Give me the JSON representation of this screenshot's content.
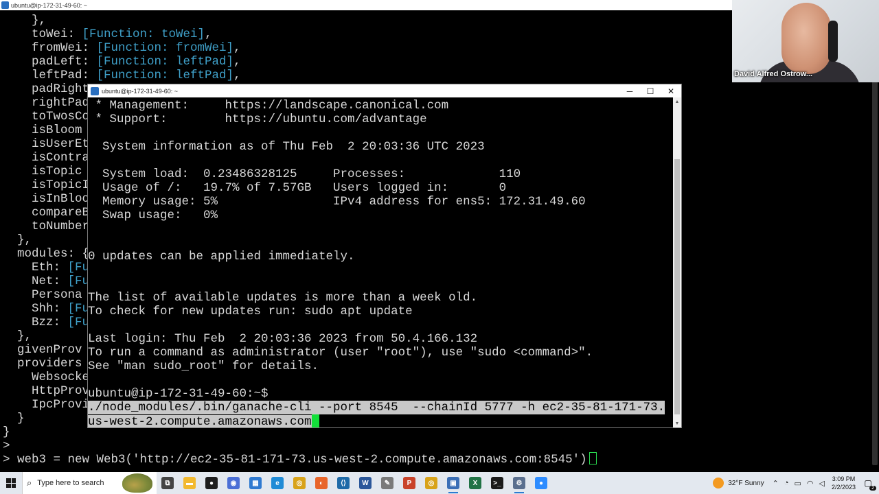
{
  "background_window": {
    "title": "ubuntu@ip-172-31-49-60: ~",
    "lines": [
      {
        "pre": "    },",
        "fn": "",
        "post": ""
      },
      {
        "pre": "    toWei: ",
        "fn": "[Function: toWei]",
        "post": ","
      },
      {
        "pre": "    fromWei: ",
        "fn": "[Function: fromWei]",
        "post": ","
      },
      {
        "pre": "    padLeft: ",
        "fn": "[Function: leftPad]",
        "post": ","
      },
      {
        "pre": "    leftPad: ",
        "fn": "[Function: leftPad]",
        "post": ","
      },
      {
        "pre": "    padRight",
        "fn": "",
        "post": ""
      },
      {
        "pre": "    rightPad",
        "fn": "",
        "post": ""
      },
      {
        "pre": "    toTwosCo",
        "fn": "",
        "post": ""
      },
      {
        "pre": "    isBloom",
        "fn": "",
        "post": ""
      },
      {
        "pre": "    isUserEt",
        "fn": "",
        "post": ""
      },
      {
        "pre": "    isContra",
        "fn": "",
        "post": ""
      },
      {
        "pre": "    isTopic",
        "fn": "",
        "post": ""
      },
      {
        "pre": "    isTopicI",
        "fn": "",
        "post": ""
      },
      {
        "pre": "    isInBloo",
        "fn": "",
        "post": ""
      },
      {
        "pre": "    compareB",
        "fn": "",
        "post": ""
      },
      {
        "pre": "    toNumber",
        "fn": "",
        "post": ""
      },
      {
        "pre": "  },",
        "fn": "",
        "post": ""
      },
      {
        "pre": "  modules: {",
        "fn": "",
        "post": ""
      },
      {
        "pre": "    Eth: ",
        "fn": "[Fu",
        "post": ""
      },
      {
        "pre": "    Net: ",
        "fn": "[Fu",
        "post": ""
      },
      {
        "pre": "    Persona",
        "fn": "",
        "post": ""
      },
      {
        "pre": "    Shh: ",
        "fn": "[Fu",
        "post": ""
      },
      {
        "pre": "    Bzz: ",
        "fn": "[Fu",
        "post": ""
      },
      {
        "pre": "  },",
        "fn": "",
        "post": ""
      },
      {
        "pre": "  givenProv",
        "fn": "",
        "post": ""
      },
      {
        "pre": "  providers",
        "fn": "",
        "post": ""
      },
      {
        "pre": "    Websocke",
        "fn": "",
        "post": ""
      },
      {
        "pre": "    HttpProv",
        "fn": "",
        "post": ""
      },
      {
        "pre": "    IpcProvi",
        "fn": "",
        "post": ""
      },
      {
        "pre": "  }",
        "fn": "",
        "post": ""
      },
      {
        "pre": "}",
        "fn": "",
        "post": ""
      },
      {
        "pre": ">",
        "fn": "",
        "post": ""
      }
    ],
    "prompt_line": "> web3 = new Web3('http://ec2-35-81-171-73.us-west-2.compute.amazonaws.com:8545')"
  },
  "webcam": {
    "participant_name": "David Alfred Ostrow..."
  },
  "foreground_window": {
    "title": "ubuntu@ip-172-31-49-60: ~",
    "controls": {
      "minimize": "─",
      "maximize": "☐",
      "close": "✕"
    },
    "lines": [
      " * Management:     https://landscape.canonical.com",
      " * Support:        https://ubuntu.com/advantage",
      "",
      "  System information as of Thu Feb  2 20:03:36 UTC 2023",
      "",
      "  System load:  0.23486328125     Processes:             110",
      "  Usage of /:   19.7% of 7.57GB   Users logged in:       0",
      "  Memory usage: 5%                IPv4 address for ens5: 172.31.49.60",
      "  Swap usage:   0%",
      "",
      "",
      "0 updates can be applied immediately.",
      "",
      "",
      "The list of available updates is more than a week old.",
      "To check for new updates run: sudo apt update",
      "",
      "Last login: Thu Feb  2 20:03:36 2023 from 50.4.166.132",
      "To run a command as administrator (user \"root\"), use \"sudo <command>\".",
      "See \"man sudo_root\" for details.",
      "",
      "ubuntu@ip-172-31-49-60:~$"
    ],
    "selected_lines": [
      "./node_modules/.bin/ganache-cli --port 8545  --chainId 5777 -h ec2-35-81-171-73.",
      "us-west-2.compute.amazonaws.com"
    ]
  },
  "taskbar": {
    "search_placeholder": "Type here to search",
    "apps": [
      {
        "name": "task-view-icon",
        "glyph": "⧉",
        "color": "#444444",
        "active": false
      },
      {
        "name": "file-explorer-icon",
        "glyph": "▬",
        "color": "#f2b92f",
        "active": false
      },
      {
        "name": "chrome-beta-icon",
        "glyph": "●",
        "color": "#1e1e1e",
        "active": false
      },
      {
        "name": "browser-icon",
        "glyph": "◉",
        "color": "#4b6fd6",
        "active": false
      },
      {
        "name": "store-icon",
        "glyph": "▦",
        "color": "#2f7ad1",
        "active": false
      },
      {
        "name": "edge-icon",
        "glyph": "e",
        "color": "#1f8bd6",
        "active": false
      },
      {
        "name": "chrome-icon",
        "glyph": "◎",
        "color": "#d8a31a",
        "active": false
      },
      {
        "name": "firefox-icon",
        "glyph": "◐",
        "color": "#e8652a",
        "active": false
      },
      {
        "name": "vscode-icon",
        "glyph": "⟨⟩",
        "color": "#1e6aa8",
        "active": false
      },
      {
        "name": "word-icon",
        "glyph": "W",
        "color": "#2b579a",
        "active": false
      },
      {
        "name": "paint-icon",
        "glyph": "✎",
        "color": "#7a7a7a",
        "active": false
      },
      {
        "name": "powerpoint-icon",
        "glyph": "P",
        "color": "#c9432a",
        "active": false
      },
      {
        "name": "chrome-2-icon",
        "glyph": "◎",
        "color": "#d8a31a",
        "active": false
      },
      {
        "name": "photos-icon",
        "glyph": "▣",
        "color": "#3b6fb6",
        "active": true
      },
      {
        "name": "excel-icon",
        "glyph": "X",
        "color": "#217346",
        "active": false
      },
      {
        "name": "terminal-icon",
        "glyph": ">_",
        "color": "#1b1b1b",
        "active": false
      },
      {
        "name": "putty-icon",
        "glyph": "⚙",
        "color": "#5a6f8f",
        "active": true
      },
      {
        "name": "zoom-icon",
        "glyph": "●",
        "color": "#2d8cff",
        "active": false
      }
    ],
    "weather": {
      "temp": "32°F",
      "condition": "Sunny"
    },
    "clock": {
      "time": "3:09 PM",
      "date": "2/2/2023"
    },
    "notification_count": "2"
  }
}
